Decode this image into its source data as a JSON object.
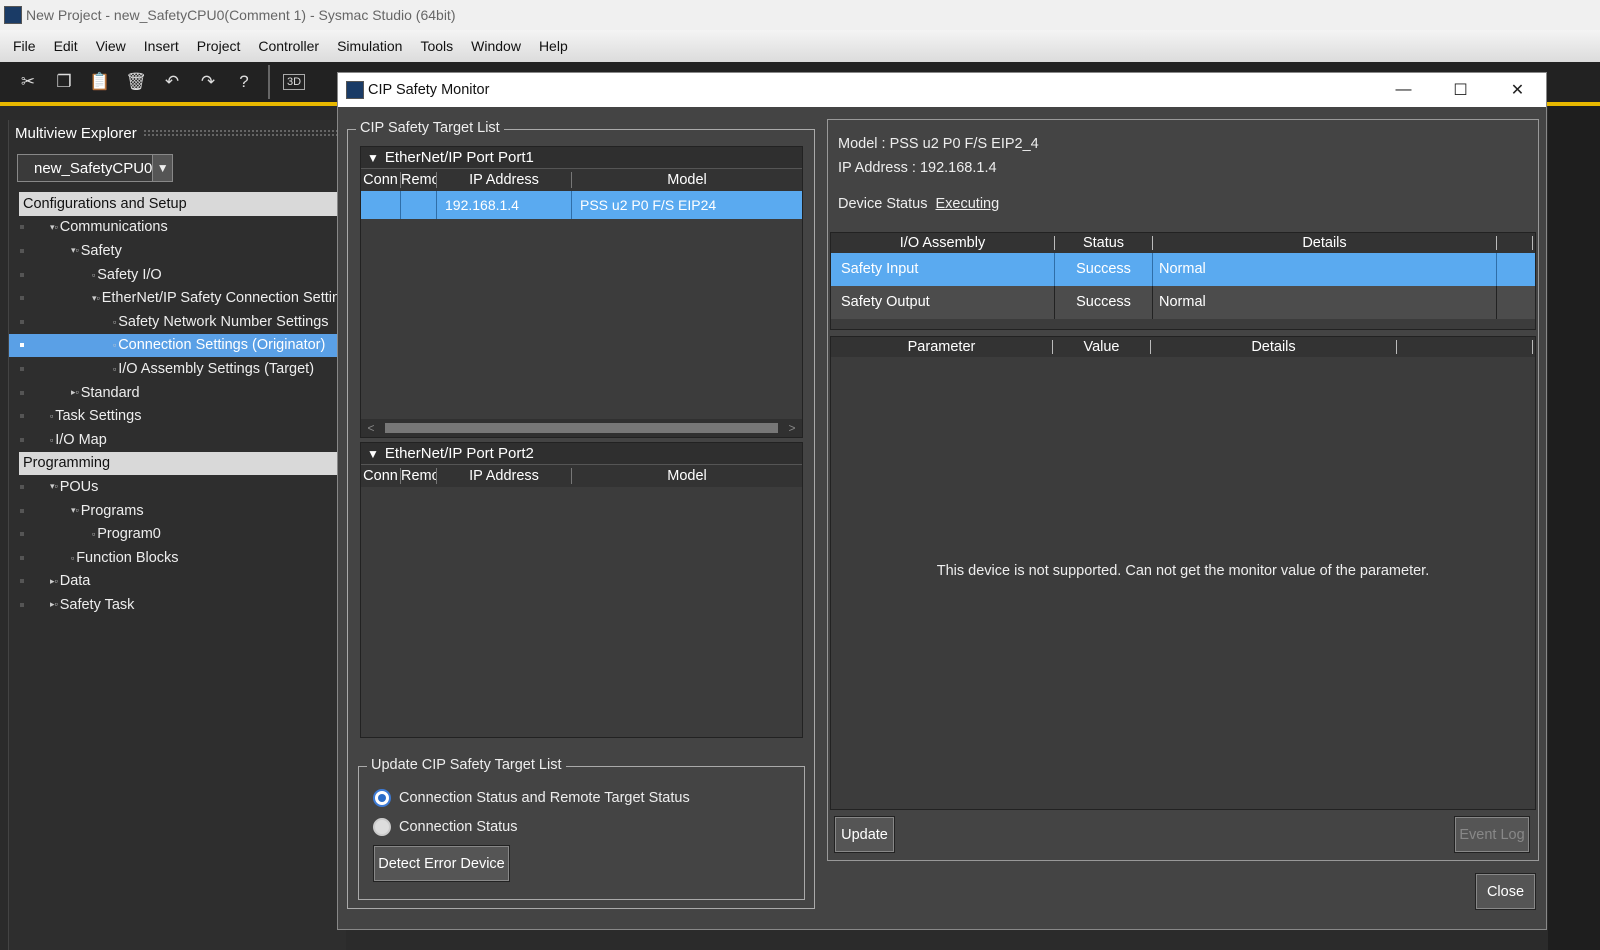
{
  "window": {
    "title": "New Project - new_SafetyCPU0(Comment 1) - Sysmac Studio (64bit)"
  },
  "menu": [
    "File",
    "Edit",
    "View",
    "Insert",
    "Project",
    "Controller",
    "Simulation",
    "Tools",
    "Window",
    "Help"
  ],
  "toolbar": {
    "icons": [
      "cut-icon",
      "copy-icon",
      "paste-icon",
      "delete-icon",
      "undo-icon",
      "redo-icon",
      "help-icon",
      "3d-icon"
    ],
    "label_3d": "3D"
  },
  "explorer": {
    "title": "Multiview Explorer",
    "controller": "new_SafetyCPU0",
    "tree": [
      {
        "label": "Configurations and Setup",
        "indent": 0,
        "twisty": "▾",
        "section": true
      },
      {
        "label": "Communications",
        "indent": 1,
        "twisty": "▾"
      },
      {
        "label": "Safety",
        "indent": 2,
        "twisty": "▾"
      },
      {
        "label": "Safety I/O",
        "indent": 3,
        "twisty": ""
      },
      {
        "label": "EtherNet/IP Safety Connection Settin",
        "indent": 3,
        "twisty": "▾"
      },
      {
        "label": "Safety Network Number Settings",
        "indent": 4,
        "twisty": ""
      },
      {
        "label": "Connection Settings (Originator)",
        "indent": 4,
        "twisty": "",
        "selected": true
      },
      {
        "label": "I/O Assembly Settings (Target)",
        "indent": 4,
        "twisty": ""
      },
      {
        "label": "Standard",
        "indent": 2,
        "twisty": "▸"
      },
      {
        "label": "Task Settings",
        "indent": 1,
        "twisty": ""
      },
      {
        "label": "I/O Map",
        "indent": 1,
        "twisty": ""
      },
      {
        "label": "Programming",
        "indent": 0,
        "twisty": "▾",
        "section": true
      },
      {
        "label": "POUs",
        "indent": 1,
        "twisty": "▾"
      },
      {
        "label": "Programs",
        "indent": 2,
        "twisty": "▾"
      },
      {
        "label": "Program0",
        "indent": 3,
        "twisty": ""
      },
      {
        "label": "Function Blocks",
        "indent": 2,
        "twisty": ""
      },
      {
        "label": "Data",
        "indent": 1,
        "twisty": "▸"
      },
      {
        "label": "Safety Task",
        "indent": 1,
        "twisty": "▸"
      }
    ]
  },
  "dialog": {
    "title": "CIP Safety Monitor",
    "win_buttons": {
      "minimize": "—",
      "maximize": "☐",
      "close": "✕"
    },
    "target_list": {
      "label": "CIP Safety Target List",
      "port1": {
        "title": "EtherNet/IP Port Port1",
        "columns": [
          "Conn",
          "Remo",
          "IP Address",
          "Model"
        ],
        "rows": [
          {
            "conn": "",
            "remote": "",
            "ip": "192.168.1.4",
            "model": "PSS u2 P0 F/S EIP24"
          }
        ]
      },
      "port2": {
        "title": "EtherNet/IP Port Port2",
        "columns": [
          "Conn",
          "Remo",
          "IP Address",
          "Model"
        ]
      }
    },
    "update_group": {
      "label": "Update CIP Safety Target List",
      "options": [
        "Connection Status and Remote Target Status",
        "Connection Status"
      ],
      "selected_index": 0,
      "detect_button": "Detect Error Device"
    },
    "device": {
      "model_label": "Model :",
      "model_value": "PSS u2 P0 F/S EIP2_4",
      "ip_label": "IP Address :",
      "ip_value": "192.168.1.4",
      "status_label": "Device Status",
      "status_value": "Executing"
    },
    "assembly_table": {
      "columns": [
        "I/O Assembly",
        "Status",
        "Details"
      ],
      "rows": [
        {
          "assembly": "Safety Input",
          "status": "Success",
          "details": "Normal"
        },
        {
          "assembly": "Safety Output",
          "status": "Success",
          "details": "Normal"
        }
      ]
    },
    "param_table": {
      "columns": [
        "Parameter",
        "Value",
        "Details"
      ],
      "message": "This device is not supported. Can not get the monitor value of the parameter."
    },
    "buttons": {
      "update": "Update",
      "event_log": "Event Log",
      "close": "Close"
    }
  }
}
